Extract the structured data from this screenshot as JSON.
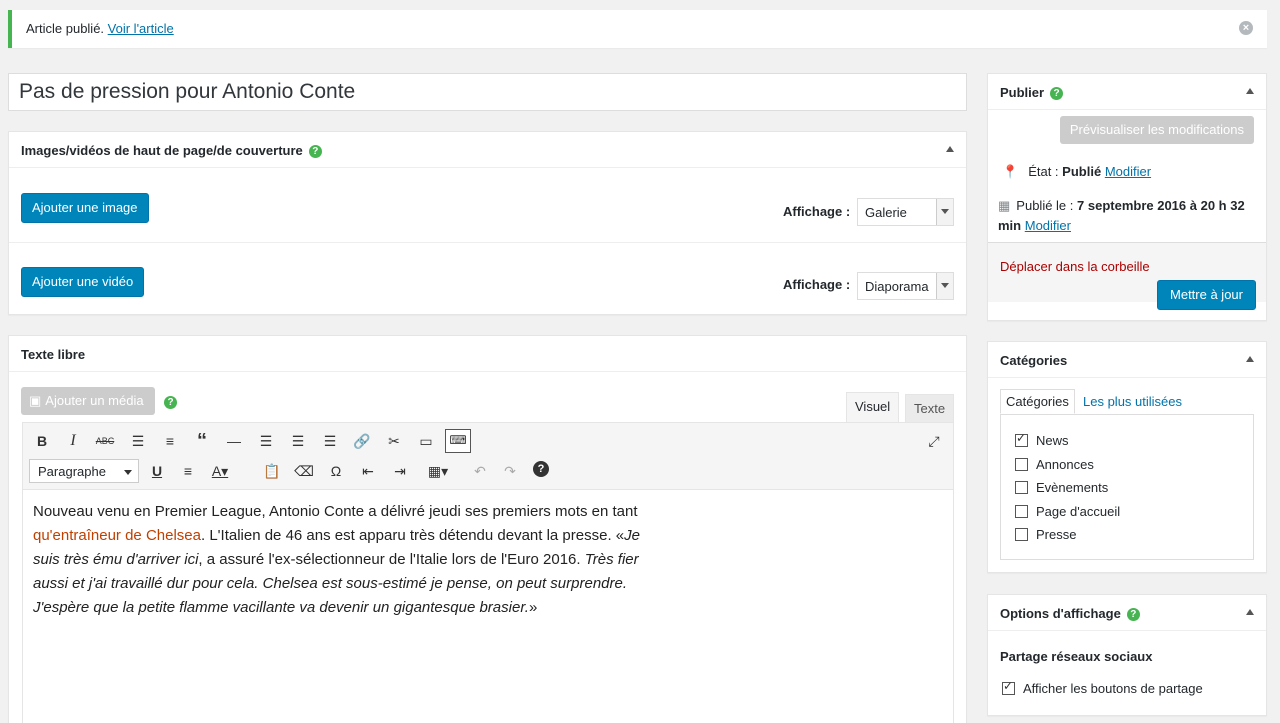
{
  "notice": {
    "text": "Article publié.",
    "link": "Voir l'article"
  },
  "post": {
    "title": "Pas de pression pour Antonio Conte"
  },
  "media_box": {
    "title": "Images/vidéos de haut de page/de couverture",
    "add_image": "Ajouter une image",
    "add_video": "Ajouter une vidéo",
    "display_label_1": "Affichage :",
    "display_value_1": "Galerie",
    "display_label_2": "Affichage :",
    "display_value_2": "Diaporama"
  },
  "text_box": {
    "title": "Texte libre",
    "add_media": "Ajouter un média",
    "tab_visual": "Visuel",
    "tab_text": "Texte",
    "format_select": "Paragraphe",
    "content_1": "Nouveau venu en Premier League, Antonio Conte a délivré jeudi ses premiers mots en tant ",
    "content_link": "qu'entraîneur de Chelsea",
    "content_2": ". L'Italien de 46 ans est apparu très détendu devant la presse. «",
    "content_3": "Je suis très ému d'arriver ici",
    "content_4": ", a assuré l'ex-sélectionneur de l'Italie lors de l'Euro 2016. ",
    "content_5": "Très fier aussi et j'ai travaillé dur pour cela. Chelsea est sous-estimé je pense, on peut surprendre. J'espère que la petite flamme vacillante va devenir un gigantesque brasier.",
    "content_6": "»"
  },
  "publish_box": {
    "title": "Publier",
    "preview": "Prévisualiser les modifications",
    "status_label": "État :",
    "status_value": "Publié",
    "status_edit": "Modifier",
    "published_label": "Publié le :",
    "published_value": "7 septembre 2016 à 20 h 32 min",
    "published_edit": "Modifier",
    "trash": "Déplacer dans la corbeille",
    "update": "Mettre à jour"
  },
  "categories_box": {
    "title": "Catégories",
    "tab_all": "Catégories",
    "tab_popular": "Les plus utilisées",
    "items": [
      {
        "label": "News",
        "checked": true
      },
      {
        "label": "Annonces",
        "checked": false
      },
      {
        "label": "Evènements",
        "checked": false
      },
      {
        "label": "Page d'accueil",
        "checked": false
      },
      {
        "label": "Presse",
        "checked": false
      }
    ]
  },
  "display_options_box": {
    "title": "Options d'affichage",
    "section": "Partage réseaux sociaux",
    "share_label": "Afficher les boutons de partage",
    "share_checked": true
  }
}
